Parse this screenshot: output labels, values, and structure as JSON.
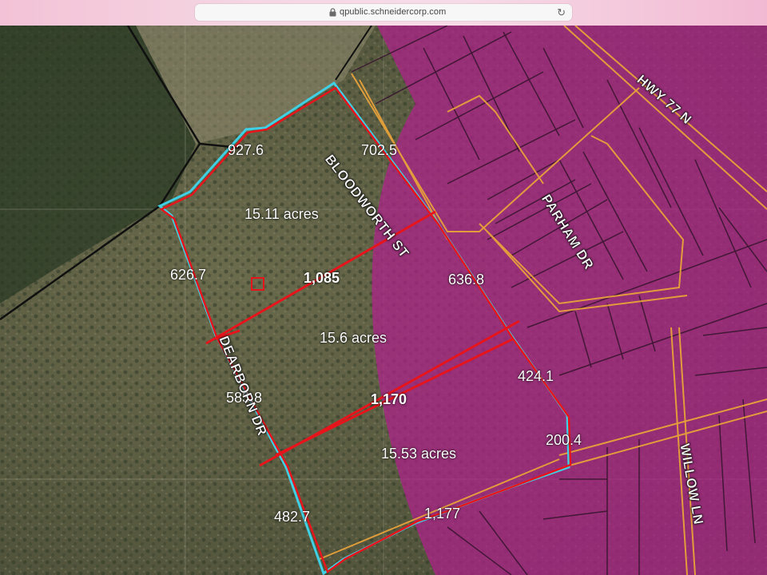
{
  "browser": {
    "url": "qpublic.schneidercorp.com",
    "lock_icon": "lock-icon",
    "reload_icon": "reload-icon"
  },
  "map": {
    "measurements": {
      "top_north": "927.6",
      "top_east": "702.5",
      "west_upper": "626.7",
      "west_lower": "583.8",
      "east_upper": "636.8",
      "east_lower": "424.1",
      "southeast": "200.4",
      "south_west": "482.7",
      "south_east": "1,177",
      "division_north": "1,085",
      "division_south": "1,170"
    },
    "acreage": {
      "tract_north": "15.11 acres",
      "tract_middle": "15.6 acres",
      "tract_south": "15.53 acres"
    },
    "streets": {
      "bloodworth": "BLOODWORTH ST",
      "hwy": "HWY 77 N",
      "parham": "PARHAM DR",
      "willow": "WILLOW LN",
      "dearborn": "DEARBORN DR"
    },
    "colors": {
      "boundary_red": "#e8141c",
      "boundary_cyan": "#3fd0e6",
      "road_orange": "#e8a23a",
      "zone_magenta": "#b0208c"
    }
  }
}
